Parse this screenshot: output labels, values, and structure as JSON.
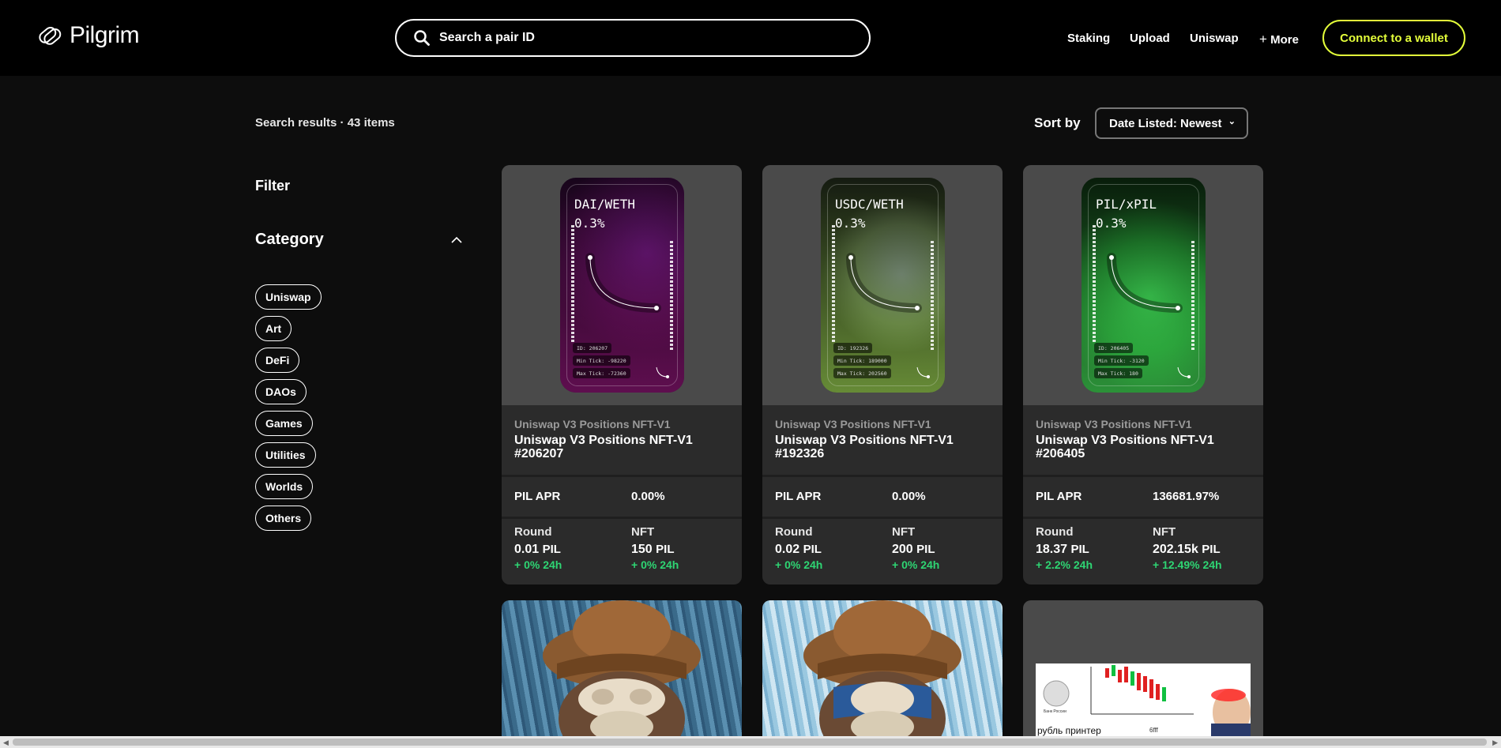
{
  "header": {
    "brand": "Pilgrim",
    "search_placeholder": "Search a pair ID",
    "nav": [
      "Staking",
      "Upload",
      "Uniswap",
      "More"
    ],
    "more_prefix": "+",
    "connect_label": "Connect to a wallet",
    "accent_color": "#e4ff3a"
  },
  "results": {
    "summary": "Search results · 43 items",
    "sort_label": "Sort by",
    "sort_value": "Date Listed: Newest"
  },
  "sidebar": {
    "filter_title": "Filter",
    "category_title": "Category",
    "categories": [
      "Uniswap",
      "Art",
      "DeFi",
      "DAOs",
      "Games",
      "Utilities",
      "Worlds",
      "Others"
    ]
  },
  "cards": [
    {
      "collection": "Uniswap V3 Positions NFT-V1",
      "name": "Uniswap V3 Positions NFT-V1 #206207",
      "pair": "DAI/WETH",
      "fee": "0.3%",
      "id_tag": "ID: 206207",
      "min_tick": "Min Tick: -98220",
      "max_tick": "Max Tick: -72360",
      "apr_label": "PIL APR",
      "apr_value": "0.00%",
      "round_label": "Round",
      "round_value": "0.01",
      "round_unit": "PIL",
      "round_change": "+ 0% 24h",
      "nft_label": "NFT",
      "nft_value": "150",
      "nft_unit": "PIL",
      "nft_change": "+ 0% 24h"
    },
    {
      "collection": "Uniswap V3 Positions NFT-V1",
      "name": "Uniswap V3 Positions NFT-V1 #192326",
      "pair": "USDC/WETH",
      "fee": "0.3%",
      "id_tag": "ID: 192326",
      "min_tick": "Min Tick: 189000",
      "max_tick": "Max Tick: 202560",
      "apr_label": "PIL APR",
      "apr_value": "0.00%",
      "round_label": "Round",
      "round_value": "0.02",
      "round_unit": "PIL",
      "round_change": "+ 0% 24h",
      "nft_label": "NFT",
      "nft_value": "200",
      "nft_unit": "PIL",
      "nft_change": "+ 0% 24h"
    },
    {
      "collection": "Uniswap V3 Positions NFT-V1",
      "name": "Uniswap V3 Positions NFT-V1 #206405",
      "pair": "PIL/xPIL",
      "fee": "0.3%",
      "id_tag": "ID: 206405",
      "min_tick": "Min Tick: -3120",
      "max_tick": "Max Tick: 180",
      "apr_label": "PIL APR",
      "apr_value": "136681.97%",
      "round_label": "Round",
      "round_value": "18.37",
      "round_unit": "PIL",
      "round_change": "+ 2.2% 24h",
      "nft_label": "NFT",
      "nft_value": "202.15k",
      "nft_unit": "PIL",
      "nft_change": "+ 12.49% 24h"
    }
  ],
  "bottom_cards": [
    {
      "image": "ape-painting-brown-hat"
    },
    {
      "image": "ape-painting-blue-mask"
    },
    {
      "image": "ruble-printer-meme",
      "caption": "рубль принтер",
      "small_label": "Банк России",
      "chart_label": "6fff"
    }
  ],
  "status_color": "#2ed573"
}
